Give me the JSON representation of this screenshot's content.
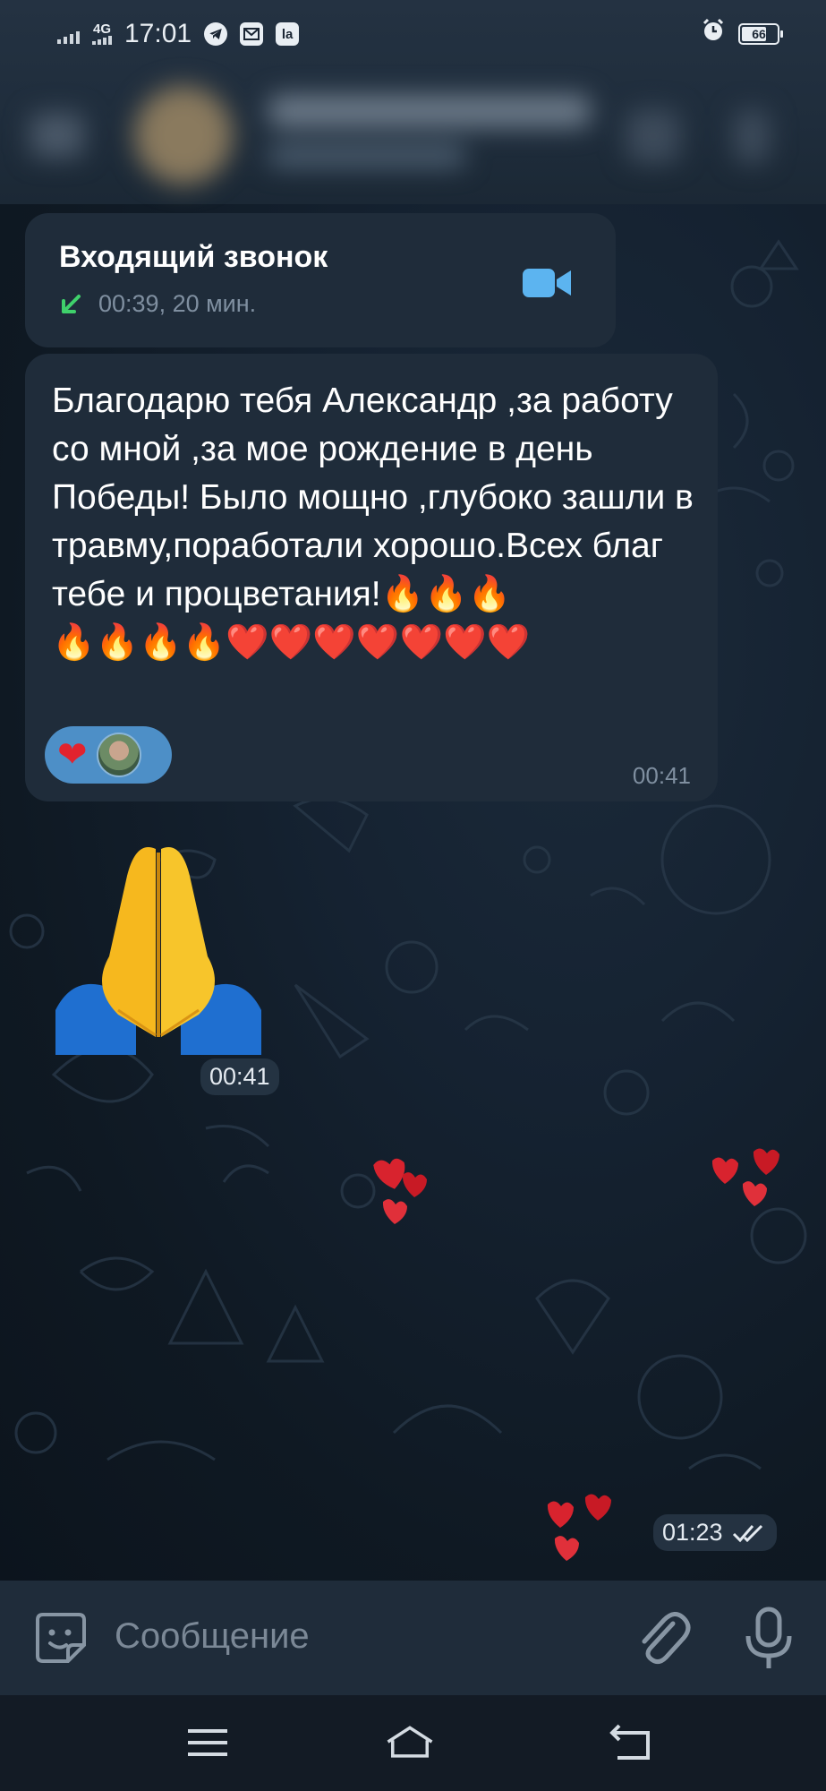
{
  "status_bar": {
    "network": "4G",
    "time": "17:01",
    "battery": "66",
    "notification_icons": [
      "telegram-icon",
      "mail-icon",
      "la-icon"
    ],
    "la_text": "la"
  },
  "messages": {
    "call": {
      "title": "Входящий звонок",
      "meta": "00:39, 20 мин.",
      "icon": "video-camera-icon"
    },
    "text": {
      "body": "Благодарю тебя Александр ,за работу со мной ,за мое рождение в день Победы! Было мощно ,глубоко зашли в травму,поработали хорошо.Всех благ тебе и процветания!🔥🔥🔥\n🔥🔥🔥🔥❤️❤️❤️❤️❤️❤️❤️",
      "reaction": "❤",
      "time": "00:41"
    },
    "pray_emoji": {
      "time": "00:41"
    },
    "last": {
      "time": "01:23",
      "status": "read"
    }
  },
  "input": {
    "placeholder": "Сообщение"
  },
  "colors": {
    "bubble": "#1f2c3a",
    "accent": "#4d8fc7",
    "muted_text": "#7f8fa0",
    "incoming_arrow": "#3fd16b",
    "heart": "#e2232e"
  }
}
